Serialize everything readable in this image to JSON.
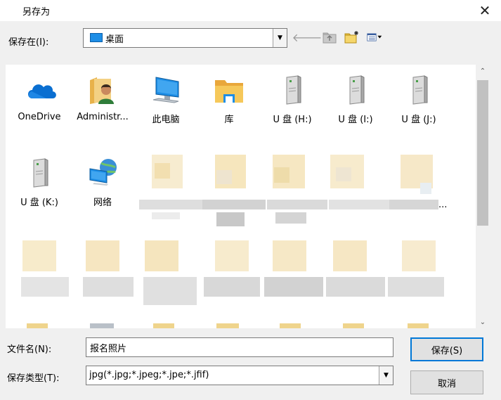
{
  "window": {
    "title": "另存为",
    "close_glyph": "✕"
  },
  "location": {
    "label": "保存在(I):",
    "value": "桌面"
  },
  "files": [
    {
      "label": "OneDrive",
      "icon": "onedrive-icon"
    },
    {
      "label": "Administr...",
      "icon": "user-folder-icon"
    },
    {
      "label": "此电脑",
      "icon": "computer-icon"
    },
    {
      "label": "库",
      "icon": "library-folder-icon"
    },
    {
      "label": "U 盘 (H:)",
      "icon": "usb-drive-icon"
    },
    {
      "label": "U 盘 (I:)",
      "icon": "usb-drive-icon"
    },
    {
      "label": "U 盘 (J:)",
      "icon": "usb-drive-icon"
    },
    {
      "label": "U 盘 (K:)",
      "icon": "usb-drive-icon"
    },
    {
      "label": "网络",
      "icon": "network-icon"
    }
  ],
  "blurred_label_suffix": "...",
  "filename": {
    "label": "文件名(N):",
    "value": "报名照片"
  },
  "filetype": {
    "label": "保存类型(T):",
    "value": "jpg(*.jpg;*.jpeg;*.jpe;*.jfif)"
  },
  "buttons": {
    "save": "保存(S)",
    "cancel": "取消"
  }
}
